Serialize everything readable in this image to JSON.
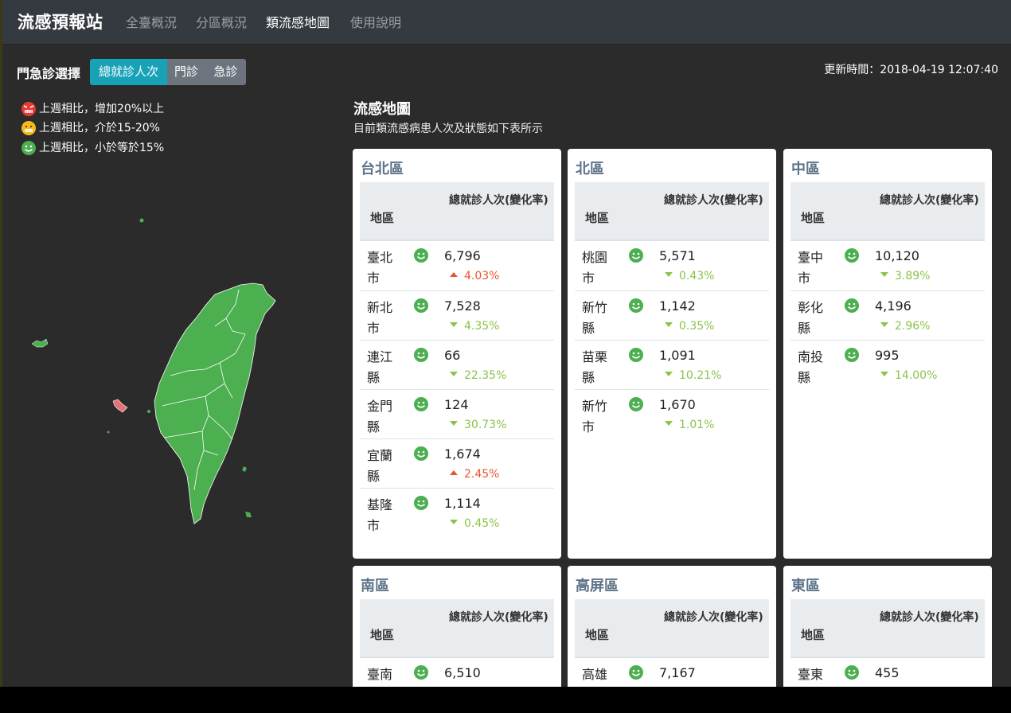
{
  "navbar": {
    "brand": "流感預報站",
    "links": [
      "全臺概況",
      "分區概況",
      "類流感地圖",
      "使用說明"
    ],
    "active_index": 2
  },
  "toolbar": {
    "label": "門急診選擇",
    "options": [
      "總就診人次",
      "門診",
      "急診"
    ],
    "active_index": 0,
    "update_time": "更新時間：2018-04-19 12:07:40"
  },
  "legend": [
    {
      "icon": "red-angry-face-icon",
      "text": "上週相比，增加20%以上",
      "color": "#e53935"
    },
    {
      "icon": "yellow-neutral-face-icon",
      "text": "上週相比，介於15-20%",
      "color": "#f5b921"
    },
    {
      "icon": "green-smile-face-icon",
      "text": "上週相比，小於等於15%",
      "color": "#4caf50"
    }
  ],
  "map_section": {
    "title": "流感地圖",
    "subtitle": "目前類流感病患人次及狀態如下表所示"
  },
  "colors": {
    "map_fill": "#4caf50",
    "face_green": "#4caf50",
    "up_red": "#e8552f",
    "down_green": "#8bc34a",
    "card_title": "#5d7388",
    "highlight_cyan": "#17a2b8"
  },
  "table_headers": {
    "area": "地區",
    "total": "總就診人次(變化率)"
  },
  "regions": [
    {
      "title": "台北區",
      "rows": [
        {
          "name": "臺北市",
          "value": "6,796",
          "change": "4.03%",
          "dir": "up",
          "face": "green-smile-face-icon"
        },
        {
          "name": "新北市",
          "value": "7,528",
          "change": "4.35%",
          "dir": "down",
          "face": "green-smile-face-icon"
        },
        {
          "name": "連江縣",
          "value": "66",
          "change": "22.35%",
          "dir": "down",
          "face": "green-smile-face-icon"
        },
        {
          "name": "金門縣",
          "value": "124",
          "change": "30.73%",
          "dir": "down",
          "face": "green-smile-face-icon"
        },
        {
          "name": "宜蘭縣",
          "value": "1,674",
          "change": "2.45%",
          "dir": "up",
          "face": "green-smile-face-icon"
        },
        {
          "name": "基隆市",
          "value": "1,114",
          "change": "0.45%",
          "dir": "down",
          "face": "green-smile-face-icon"
        }
      ]
    },
    {
      "title": "北區",
      "rows": [
        {
          "name": "桃園市",
          "value": "5,571",
          "change": "0.43%",
          "dir": "down",
          "face": "green-smile-face-icon"
        },
        {
          "name": "新竹縣",
          "value": "1,142",
          "change": "0.35%",
          "dir": "down",
          "face": "green-smile-face-icon"
        },
        {
          "name": "苗栗縣",
          "value": "1,091",
          "change": "10.21%",
          "dir": "down",
          "face": "green-smile-face-icon"
        },
        {
          "name": "新竹市",
          "value": "1,670",
          "change": "1.01%",
          "dir": "down",
          "face": "green-smile-face-icon"
        }
      ]
    },
    {
      "title": "中區",
      "rows": [
        {
          "name": "臺中市",
          "value": "10,120",
          "change": "3.89%",
          "dir": "down",
          "face": "green-smile-face-icon"
        },
        {
          "name": "彰化縣",
          "value": "4,196",
          "change": "2.96%",
          "dir": "down",
          "face": "green-smile-face-icon"
        },
        {
          "name": "南投縣",
          "value": "995",
          "change": "14.00%",
          "dir": "down",
          "face": "green-smile-face-icon"
        }
      ]
    },
    {
      "title": "南區",
      "rows": [
        {
          "name": "臺南",
          "value": "6,510",
          "change": "",
          "dir": "down",
          "face": "green-smile-face-icon"
        }
      ]
    },
    {
      "title": "高屏區",
      "rows": [
        {
          "name": "高雄",
          "value": "7,167",
          "change": "",
          "dir": "down",
          "face": "green-smile-face-icon"
        }
      ]
    },
    {
      "title": "東區",
      "rows": [
        {
          "name": "臺東",
          "value": "455",
          "change": "",
          "dir": "down",
          "face": "green-smile-face-icon"
        }
      ]
    }
  ]
}
